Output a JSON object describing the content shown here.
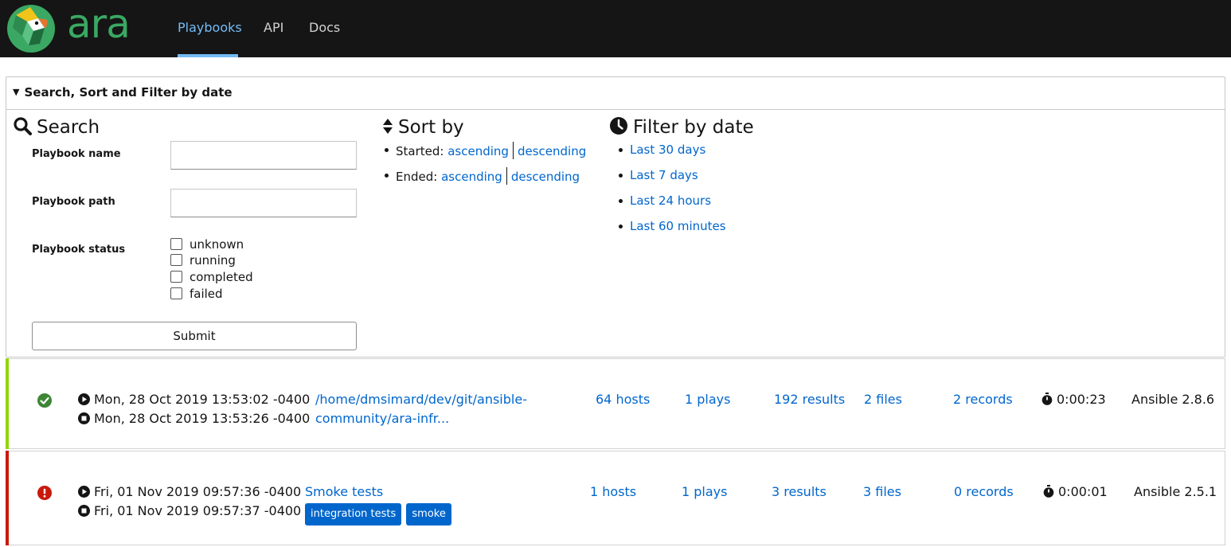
{
  "app": {
    "logo_text": "ara",
    "nav": {
      "playbooks": "Playbooks",
      "api": "API",
      "docs": "Docs"
    }
  },
  "search_panel": {
    "summary": "Search, Sort and Filter by date",
    "search": {
      "title": "Search",
      "playbook_name_label": "Playbook name",
      "playbook_name_value": "",
      "playbook_path_label": "Playbook path",
      "playbook_path_value": "",
      "playbook_status_label": "Playbook status",
      "statuses": [
        "unknown",
        "running",
        "completed",
        "failed"
      ],
      "submit_label": "Submit"
    },
    "sort": {
      "title": "Sort by",
      "started_label": "Started:",
      "ended_label": "Ended:",
      "ascending": "ascending",
      "descending": "descending"
    },
    "filter": {
      "title": "Filter by date",
      "options": [
        "Last 30 days",
        "Last 7 days",
        "Last 24 hours",
        "Last 60 minutes"
      ]
    }
  },
  "playbooks": [
    {
      "status": "completed",
      "status_color": "#92d400",
      "started": "Mon, 28 Oct 2019 13:53:02 -0400",
      "ended": "Mon, 28 Oct 2019 13:53:26 -0400",
      "name_line1": "/home/dmsimard/dev/git/ansible-",
      "name_line2": "community/ara-infr...",
      "tags": [],
      "hosts": "64 hosts",
      "plays": "1 plays",
      "results": "192 results",
      "files": "2 files",
      "records": "2 records",
      "duration": "0:00:23",
      "ansible_version": "Ansible 2.8.6"
    },
    {
      "status": "failed",
      "status_color": "#c9190b",
      "started": "Fri, 01 Nov 2019 09:57:36 -0400",
      "ended": "Fri, 01 Nov 2019 09:57:37 -0400",
      "name_line1": "Smoke tests",
      "name_line2": "",
      "tags": [
        "integration tests",
        "smoke"
      ],
      "hosts": "1 hosts",
      "plays": "1 plays",
      "results": "3 results",
      "files": "3 files",
      "records": "0 records",
      "duration": "0:00:01",
      "ansible_version": "Ansible 2.5.1"
    }
  ]
}
